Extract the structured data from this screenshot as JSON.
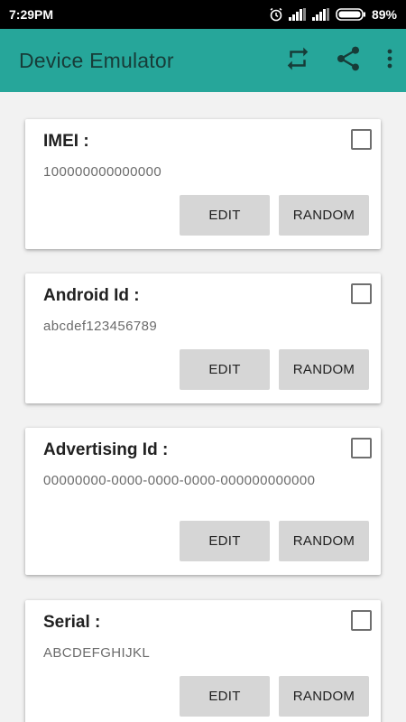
{
  "status_bar": {
    "time": "7:29PM",
    "battery_percent": "89%",
    "icons": [
      "alarm-icon",
      "signal-icon",
      "signal-icon",
      "battery-icon"
    ]
  },
  "app_bar": {
    "title": "Device Emulator",
    "background_color": "#26a69a",
    "actions": [
      "repeat-icon",
      "share-icon",
      "more-vert-icon"
    ]
  },
  "cards": [
    {
      "title": "IMEI :",
      "value": "100000000000000",
      "checked": false
    },
    {
      "title": "Android Id :",
      "value": "abcdef123456789",
      "checked": false
    },
    {
      "title": "Advertising Id :",
      "value": "00000000-0000-0000-0000-000000000000",
      "checked": false
    },
    {
      "title": "Serial :",
      "value": "ABCDEFGHIJKL",
      "checked": false
    }
  ],
  "buttons": {
    "edit_label": "EDIT",
    "random_label": "RANDOM"
  }
}
